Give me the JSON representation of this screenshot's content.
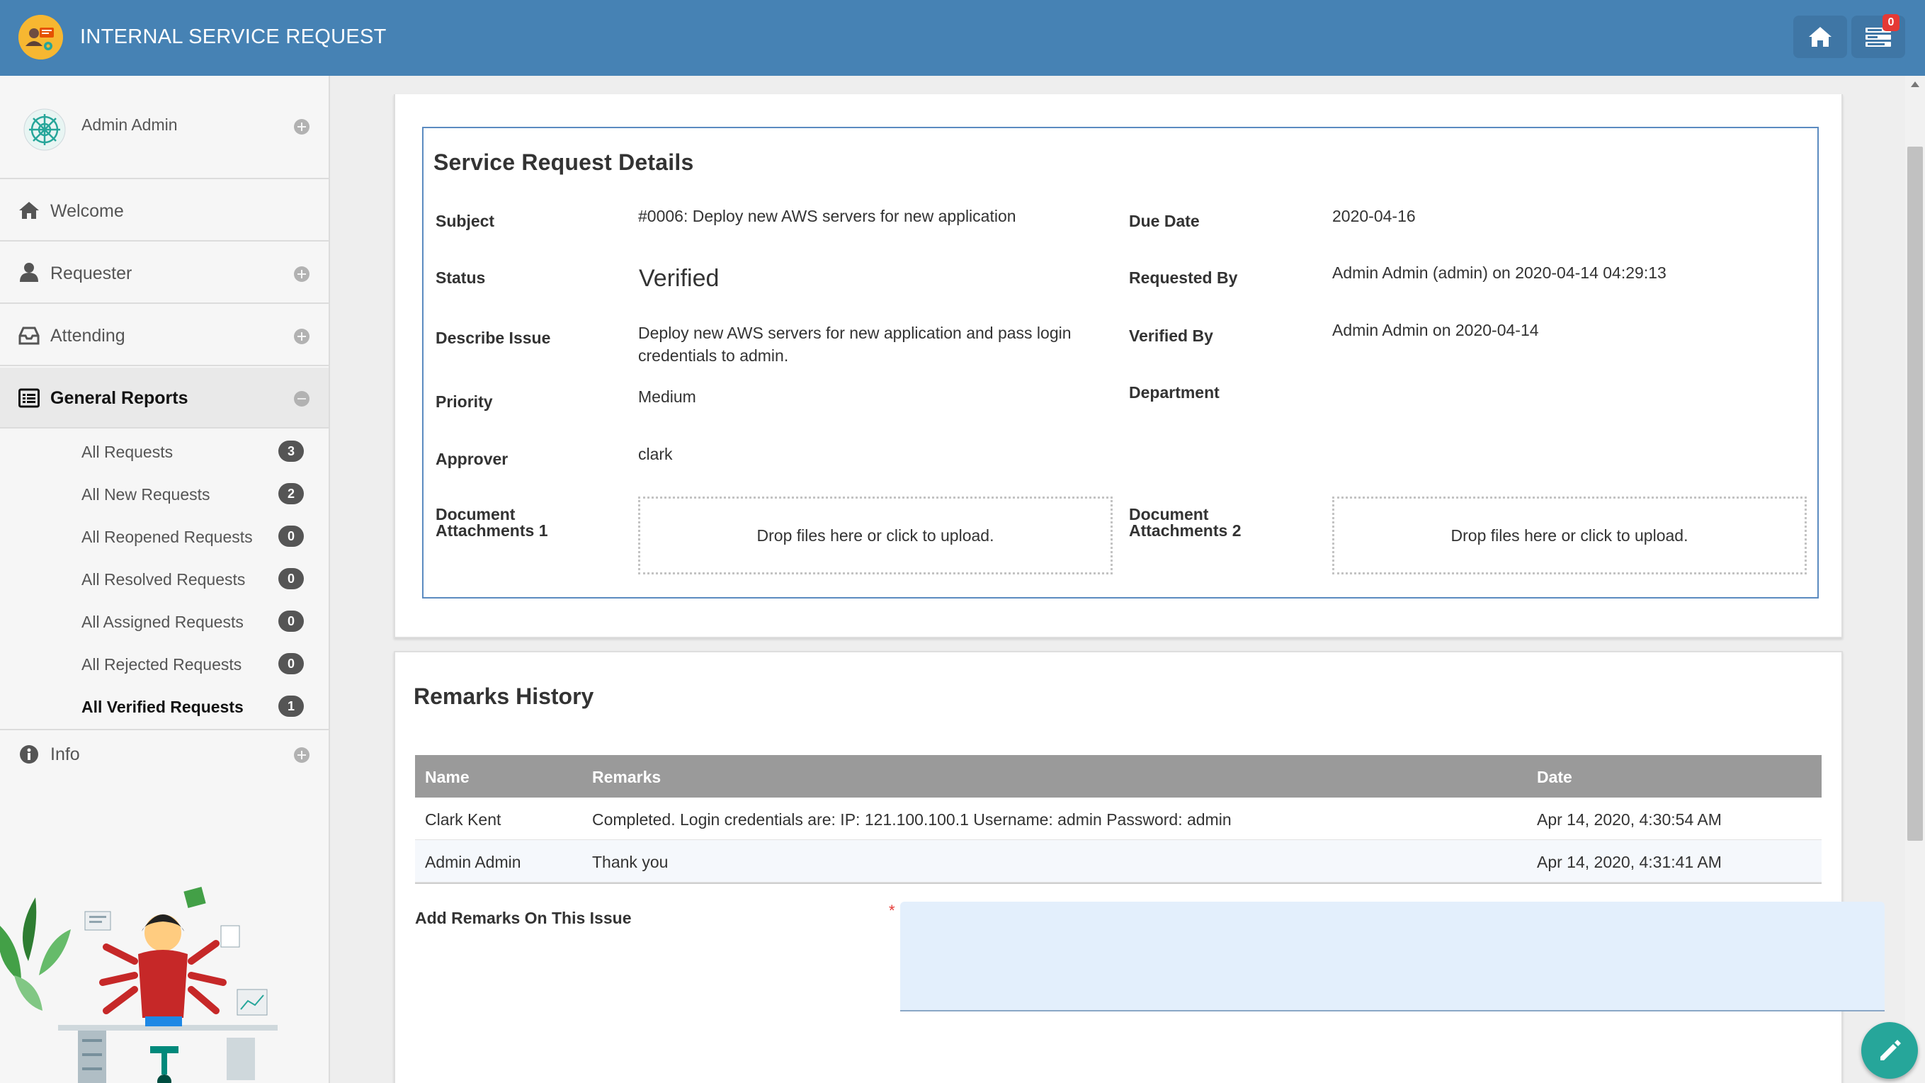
{
  "app": {
    "title": "INTERNAL SERVICE REQUEST",
    "notification_count": "0",
    "accent": "#4682b4"
  },
  "sidebar": {
    "profile_name": "Admin Admin",
    "items": [
      {
        "label": "Welcome",
        "icon": "home-icon"
      },
      {
        "label": "Requester",
        "icon": "user-icon"
      },
      {
        "label": "Attending",
        "icon": "inbox-icon"
      },
      {
        "label": "General Reports",
        "icon": "list-icon"
      },
      {
        "label": "Info",
        "icon": "info-icon"
      }
    ],
    "reports": [
      {
        "label": "All Requests",
        "count": "3"
      },
      {
        "label": "All New Requests",
        "count": "2"
      },
      {
        "label": "All Reopened Requests",
        "count": "0"
      },
      {
        "label": "All Resolved Requests",
        "count": "0"
      },
      {
        "label": "All Assigned Requests",
        "count": "0"
      },
      {
        "label": "All Rejected Requests",
        "count": "0"
      },
      {
        "label": "All Verified Requests",
        "count": "1"
      }
    ]
  },
  "details": {
    "title": "Service Request Details",
    "subject_label": "Subject",
    "subject": "#0006: Deploy new AWS servers for new application",
    "due_date_label": "Due Date",
    "due_date": "2020-04-16",
    "status_label": "Status",
    "status": "Verified",
    "requested_by_label": "Requested By",
    "requested_by": "Admin Admin (admin) on 2020-04-14 04:29:13",
    "describe_label": "Describe Issue",
    "describe_line1": "Deploy new AWS servers for new application and pass login",
    "describe_line2": "credentials to admin.",
    "verified_by_label": "Verified By",
    "verified_by": "Admin Admin on 2020-04-14",
    "priority_label": "Priority",
    "priority": "Medium",
    "department_label": "Department",
    "approver_label": "Approver",
    "approver": "clark",
    "doc1_label_line1": "Document",
    "doc1_label_line2": "Attachments 1",
    "doc2_label_line1": "Document",
    "doc2_label_line2": "Attachments 2",
    "dropzone_text": "Drop files here or click to upload."
  },
  "remarks": {
    "title": "Remarks History",
    "headers": {
      "name": "Name",
      "remarks": "Remarks",
      "date": "Date"
    },
    "rows": [
      {
        "name": "Clark Kent",
        "remarks": "Completed. Login credentials are: IP: 121.100.100.1 Username: admin Password: admin",
        "date": "Apr 14, 2020, 4:30:54 AM"
      },
      {
        "name": "Admin Admin",
        "remarks": "Thank you",
        "date": "Apr 14, 2020, 4:31:41 AM"
      }
    ],
    "add_label": "Add Remarks On This Issue",
    "required_mark": "*"
  }
}
